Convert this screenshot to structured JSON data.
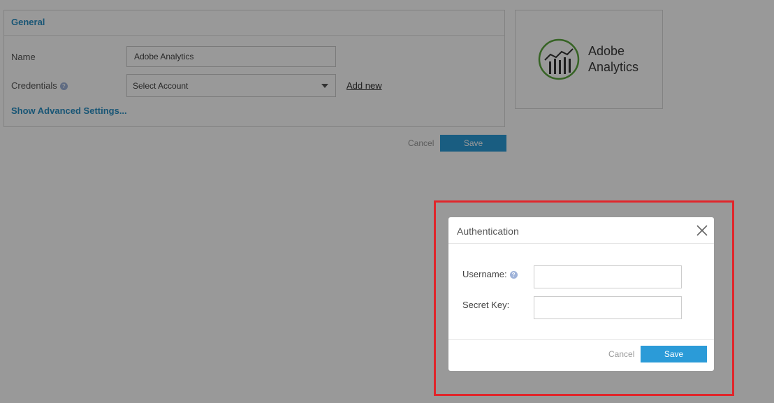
{
  "general": {
    "title": "General",
    "name_label": "Name",
    "name_value": "Adobe Analytics",
    "credentials_label": "Credentials",
    "credentials_placeholder": "Select Account",
    "add_new": "Add new",
    "advanced": "Show Advanced Settings..."
  },
  "page_actions": {
    "cancel": "Cancel",
    "save": "Save"
  },
  "logo": {
    "line1": "Adobe",
    "line2": "Analytics",
    "color": "#5aa53c"
  },
  "modal": {
    "title": "Authentication",
    "username_label": "Username:",
    "secret_label": "Secret Key:",
    "cancel": "Cancel",
    "save": "Save"
  },
  "colors": {
    "accent": "#2b9bd8",
    "highlight": "#e0262b"
  }
}
